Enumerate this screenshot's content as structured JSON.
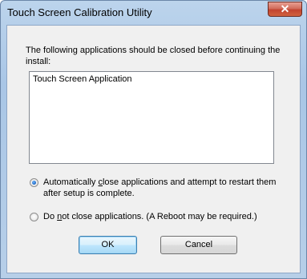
{
  "window": {
    "title": "Touch Screen Calibration Utility",
    "close_glyph": "✕"
  },
  "message": "The following applications should be closed before continuing the install:",
  "applications": [
    "Touch Screen Application"
  ],
  "options": {
    "auto_close": {
      "label_before": "Automatically ",
      "accel": "c",
      "label_after": "lose applications and attempt to restart them after setup is complete.",
      "checked": true
    },
    "do_not_close": {
      "label_before": "Do ",
      "accel": "n",
      "label_after": "ot close applications. (A Reboot may be required.)",
      "checked": false
    }
  },
  "buttons": {
    "ok": "OK",
    "cancel": "Cancel"
  },
  "colors": {
    "accent": "#3c7fb1",
    "close_button": "#c2432f",
    "frame": "#a9c6e6"
  }
}
